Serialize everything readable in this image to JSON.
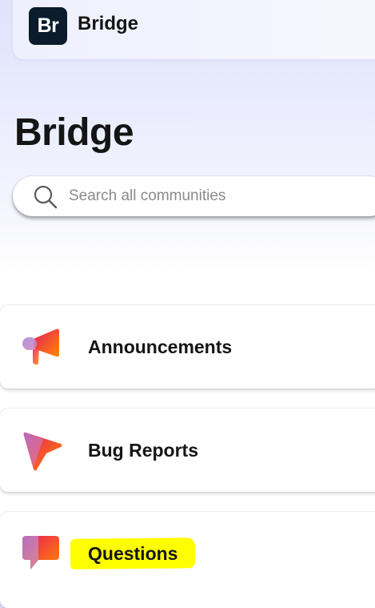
{
  "app": {
    "logo_text": "Br",
    "name": "Bridge"
  },
  "page": {
    "title": "Bridge"
  },
  "search": {
    "placeholder": "Search all communities",
    "value": ""
  },
  "categories": [
    {
      "label": "Announcements",
      "icon": "megaphone-icon"
    },
    {
      "label": "Bug Reports",
      "icon": "bug-report-icon"
    },
    {
      "label": "Questions",
      "icon": "chat-bubble-icon",
      "highlighted": true
    }
  ],
  "colors": {
    "logo_background": "#0b1c2c",
    "highlight": "#ffff00",
    "icon_gradient_start": "#e8175d",
    "icon_gradient_end": "#ff8a00",
    "icon_purple": "#a58de0"
  }
}
